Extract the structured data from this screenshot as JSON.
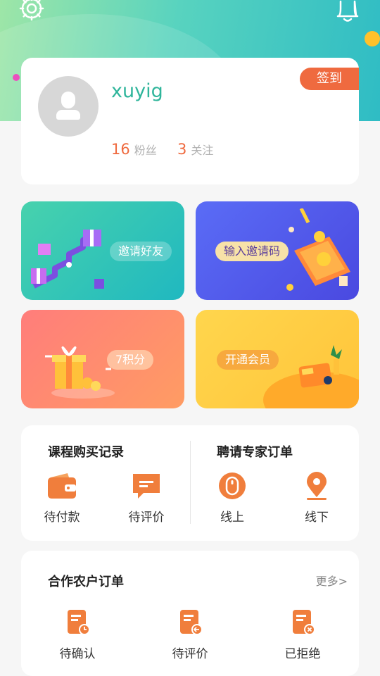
{
  "colors": {
    "accent": "#ef6a3f",
    "brand_green": "#2fb59b",
    "header_gradient_start": "#9ee6a7",
    "header_gradient_end": "#2fbcc4"
  },
  "header": {
    "settings_icon": "gear-icon",
    "notification_icon": "bell-icon"
  },
  "profile": {
    "username": "xuyig",
    "signin_label": "签到",
    "fans_count": "16",
    "fans_label": "粉丝",
    "following_count": "3",
    "following_label": "关注"
  },
  "promo_tiles": [
    {
      "label": "邀请好友"
    },
    {
      "label": "输入邀请码"
    },
    {
      "label": "7积分"
    },
    {
      "label": "开通会员"
    }
  ],
  "course_orders": {
    "title": "课程购买记录",
    "items": [
      {
        "label": "待付款",
        "icon": "wallet-icon"
      },
      {
        "label": "待评价",
        "icon": "comment-icon"
      }
    ]
  },
  "expert_orders": {
    "title": "聘请专家订单",
    "items": [
      {
        "label": "线上",
        "icon": "mouse-icon"
      },
      {
        "label": "线下",
        "icon": "location-pin-icon"
      }
    ]
  },
  "farmer_orders": {
    "title": "合作农户订单",
    "more_label": "更多>",
    "items": [
      {
        "label": "待确认",
        "icon": "doc-clock-icon"
      },
      {
        "label": "待评价",
        "icon": "doc-reply-icon"
      },
      {
        "label": "已拒绝",
        "icon": "doc-reject-icon"
      }
    ]
  }
}
